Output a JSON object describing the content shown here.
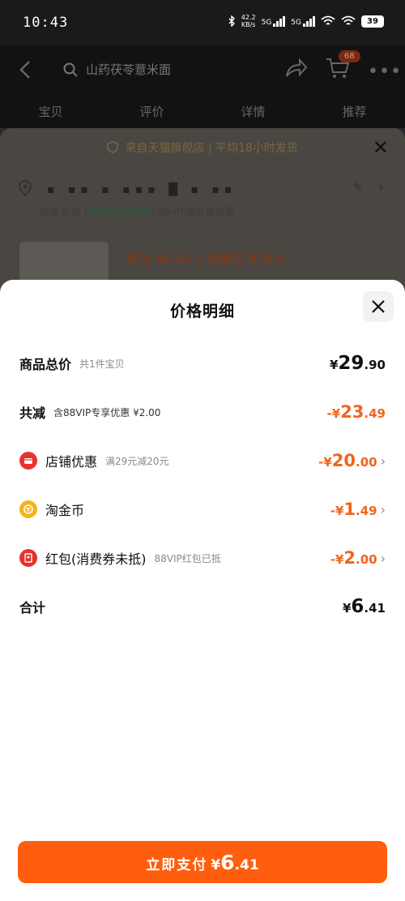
{
  "status_bar": {
    "time": "10:43",
    "net_speed": "42.2",
    "net_unit": "KB/s",
    "sig1": "5G",
    "sig2": "5G",
    "battery": "39"
  },
  "background": {
    "search_text": "山药茯苓薏米面",
    "cart_count": "68",
    "tabs": [
      "宝贝",
      "评价",
      "详情",
      "推荐"
    ],
    "store_line": "来自天猫旗舰店 | 平均18小时发货",
    "shipping_a": "快递 包邮 | ",
    "shipping_b": "预计后天送达",
    "shipping_c": " | 88VIP退货包运费",
    "price_line": "实付 ¥6.41 | 优惠前 ¥29.9"
  },
  "sheet": {
    "title": "价格明细",
    "rows": [
      {
        "label": "商品总价",
        "sub": "共1件宝贝",
        "cur": "¥",
        "int": "29",
        "dec": ".90"
      },
      {
        "label": "共减",
        "sub": "含88VIP专享优惠 ¥2.00",
        "cur": "-¥",
        "int": "23",
        "dec": ".49"
      },
      {
        "label": "店铺优惠",
        "sub": "满29元减20元",
        "cur": "-¥",
        "int": "20",
        "dec": ".00"
      },
      {
        "label": "淘金币",
        "sub": "",
        "cur": "-¥",
        "int": "1",
        "dec": ".49"
      },
      {
        "label": "红包(消费券未抵)",
        "sub": "88VIP红包已抵",
        "cur": "-¥",
        "int": "2",
        "dec": ".00"
      },
      {
        "label": "合计",
        "sub": "",
        "cur": "¥",
        "int": "6",
        "dec": ".41"
      }
    ],
    "pay_button": {
      "label": "立即支付",
      "cur": "¥",
      "int": "6",
      "dec": ".41"
    }
  },
  "colors": {
    "accent_orange": "#f2641e",
    "button_orange": "#ff5e0e",
    "store_icon_red": "#e8322c",
    "coin_icon_yellow": "#f7b21b"
  },
  "icons": [
    "back-arrow-icon",
    "search-icon",
    "share-icon",
    "cart-icon",
    "more-icon",
    "shield-icon",
    "close-icon",
    "location-icon",
    "edit-icon",
    "chevron-right-icon",
    "store-coupon-icon",
    "gold-coin-icon",
    "red-packet-icon"
  ]
}
